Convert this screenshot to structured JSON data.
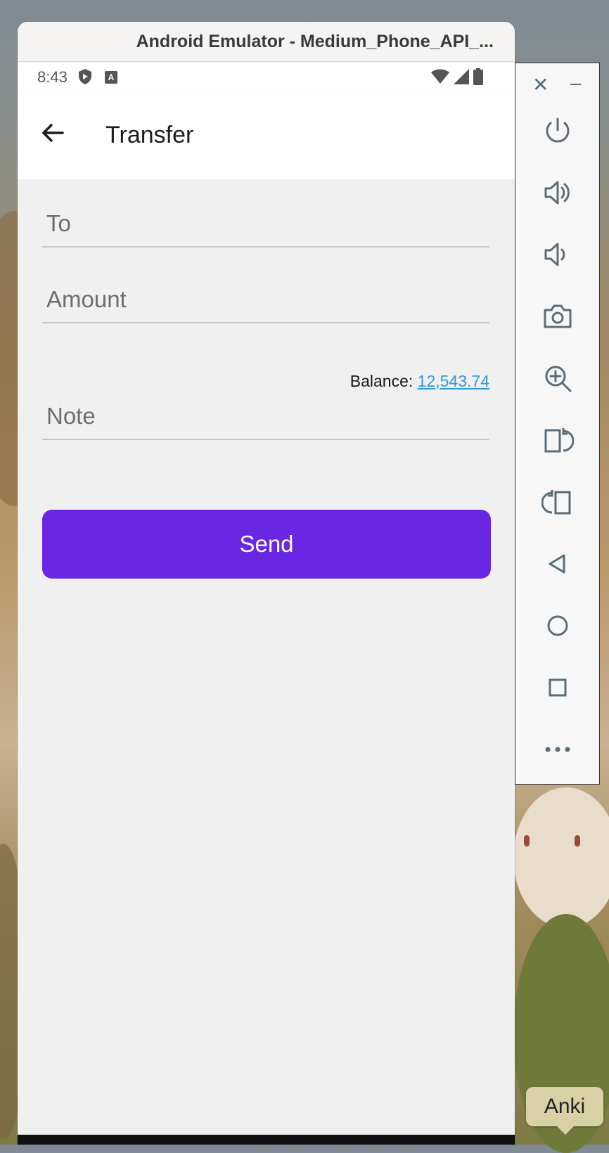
{
  "window": {
    "title": "Android Emulator - Medium_Phone_API_..."
  },
  "status_bar": {
    "time": "8:43",
    "icons": [
      "shield-icon",
      "a-icon",
      "wifi-icon",
      "signal-icon",
      "battery-icon"
    ]
  },
  "app_bar": {
    "title": "Transfer",
    "back_icon": "arrow-left-icon"
  },
  "form": {
    "to_placeholder": "To",
    "amount_placeholder": "Amount",
    "balance_label": "Balance: ",
    "balance_value": "12,543.74",
    "note_placeholder": "Note",
    "send_label": "Send"
  },
  "side_panel": {
    "buttons": [
      "power-icon",
      "volume-up-icon",
      "volume-down-icon",
      "camera-icon",
      "zoom-in-icon",
      "rotate-left-icon",
      "rotate-right-icon",
      "back-triangle-icon",
      "home-circle-icon",
      "overview-square-icon",
      "more-icon"
    ]
  },
  "tooltip": {
    "label": "Anki"
  },
  "colors": {
    "accent": "#6a27e3",
    "link": "#2e9ad6",
    "background": "#f0f0f0",
    "panel_icon": "#5a6e7a"
  }
}
